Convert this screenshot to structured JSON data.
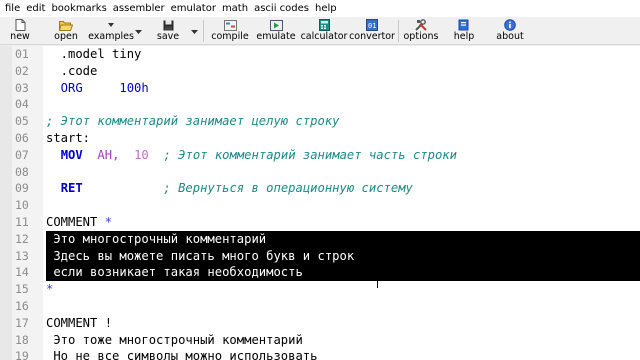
{
  "menu": [
    "file",
    "edit",
    "bookmarks",
    "assembler",
    "emulator",
    "math",
    "ascii codes",
    "help"
  ],
  "toolbar": {
    "new": "new",
    "open": "open",
    "examples": "examples",
    "save": "save",
    "compile": "compile",
    "emulate": "emulate",
    "calculator": "calculator",
    "convertor": "convertor",
    "options": "options",
    "help": "help",
    "about": "about"
  },
  "editor": {
    "lines": [
      {
        "n": "01",
        "t": "  .model tiny"
      },
      {
        "n": "02",
        "t": "  .code"
      },
      {
        "n": "03",
        "t": "  ORG     100h"
      },
      {
        "n": "04",
        "t": ""
      },
      {
        "n": "05",
        "t": "; Этот комментарий занимает целую строку"
      },
      {
        "n": "06",
        "t": "start:"
      },
      {
        "n": "07",
        "t": "  MOV  AH,  10  ; Этот комментарий занимает часть строки",
        "kw": "MOV",
        "reg": "AH,",
        "num": "10",
        "cmt": "; Этот комментарий занимает часть строки"
      },
      {
        "n": "08",
        "t": ""
      },
      {
        "n": "09",
        "t": "  RET           ; Вернуться в операционную систему",
        "kw": "RET",
        "cmt": "; Вернуться в операционную систему"
      },
      {
        "n": "10",
        "t": ""
      },
      {
        "n": "11",
        "t": "COMMENT *",
        "word": "COMMENT",
        "star": "*"
      },
      {
        "n": "12",
        "t": " Это многострочный комментарий"
      },
      {
        "n": "13",
        "t": " Здесь вы можете писать много букв и строк"
      },
      {
        "n": "14",
        "t": " если возникает такая необходимость   "
      },
      {
        "n": "15",
        "t": "*"
      },
      {
        "n": "16",
        "t": ""
      },
      {
        "n": "17",
        "t": "COMMENT !"
      },
      {
        "n": "18",
        "t": " Это тоже многострочный комментарий"
      },
      {
        "n": "19",
        "t": " Но не все символы можно использовать"
      }
    ]
  }
}
